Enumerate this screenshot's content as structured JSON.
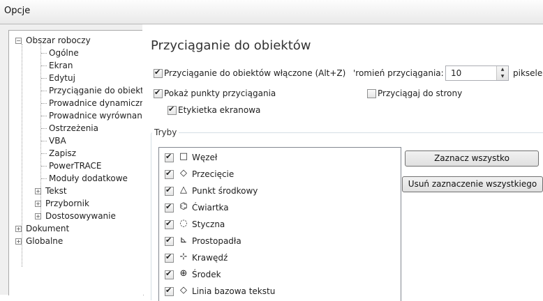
{
  "window": {
    "title": "Opcje"
  },
  "tree": {
    "items": [
      {
        "label": "Obszar roboczy"
      },
      {
        "label": "Ogólne"
      },
      {
        "label": "Ekran"
      },
      {
        "label": "Edytuj"
      },
      {
        "label": "Przyciąganie do obiekt"
      },
      {
        "label": "Prowadnice dynamiczn"
      },
      {
        "label": "Prowadnice wyrównan"
      },
      {
        "label": "Ostrzeżenia"
      },
      {
        "label": "VBA"
      },
      {
        "label": "Zapisz"
      },
      {
        "label": "PowerTRACE"
      },
      {
        "label": "Moduły dodatkowe"
      },
      {
        "label": "Tekst"
      },
      {
        "label": "Przybornik"
      },
      {
        "label": "Dostosowywanie"
      },
      {
        "label": "Dokument"
      },
      {
        "label": "Globalne"
      }
    ]
  },
  "panel": {
    "heading": "Przyciąganie do obiektów",
    "snap_enabled_label": "Przyciąganie do obiektów włączone (Alt+Z)",
    "radius_label": "'romień przyciągania:",
    "radius_value": "10",
    "radius_unit": "piksele",
    "show_points_label": "Pokaż punkty przyciągania",
    "snap_to_page_label": "Przyciągaj do strony",
    "screen_tip_label": "Etykietka ekranowa",
    "modes_label": "Tryby",
    "modes": [
      {
        "icon": "□",
        "label": "Węzeł"
      },
      {
        "icon": "◇",
        "label": "Przecięcie"
      },
      {
        "icon": "△",
        "label": "Punkt środkowy"
      },
      {
        "icon": "⌬",
        "label": "Ćwiartka"
      },
      {
        "icon": "◌",
        "label": "Styczna"
      },
      {
        "icon": "⊾",
        "label": "Prostopadła"
      },
      {
        "icon": "⊹",
        "label": "Krawędź"
      },
      {
        "icon": "⊕",
        "label": "Środek"
      },
      {
        "icon": "◇",
        "label": "Linia bazowa tekstu"
      }
    ],
    "select_all_label": "Zaznacz wszystko",
    "deselect_all_label": "Usuń zaznaczenie wszystkiego"
  }
}
